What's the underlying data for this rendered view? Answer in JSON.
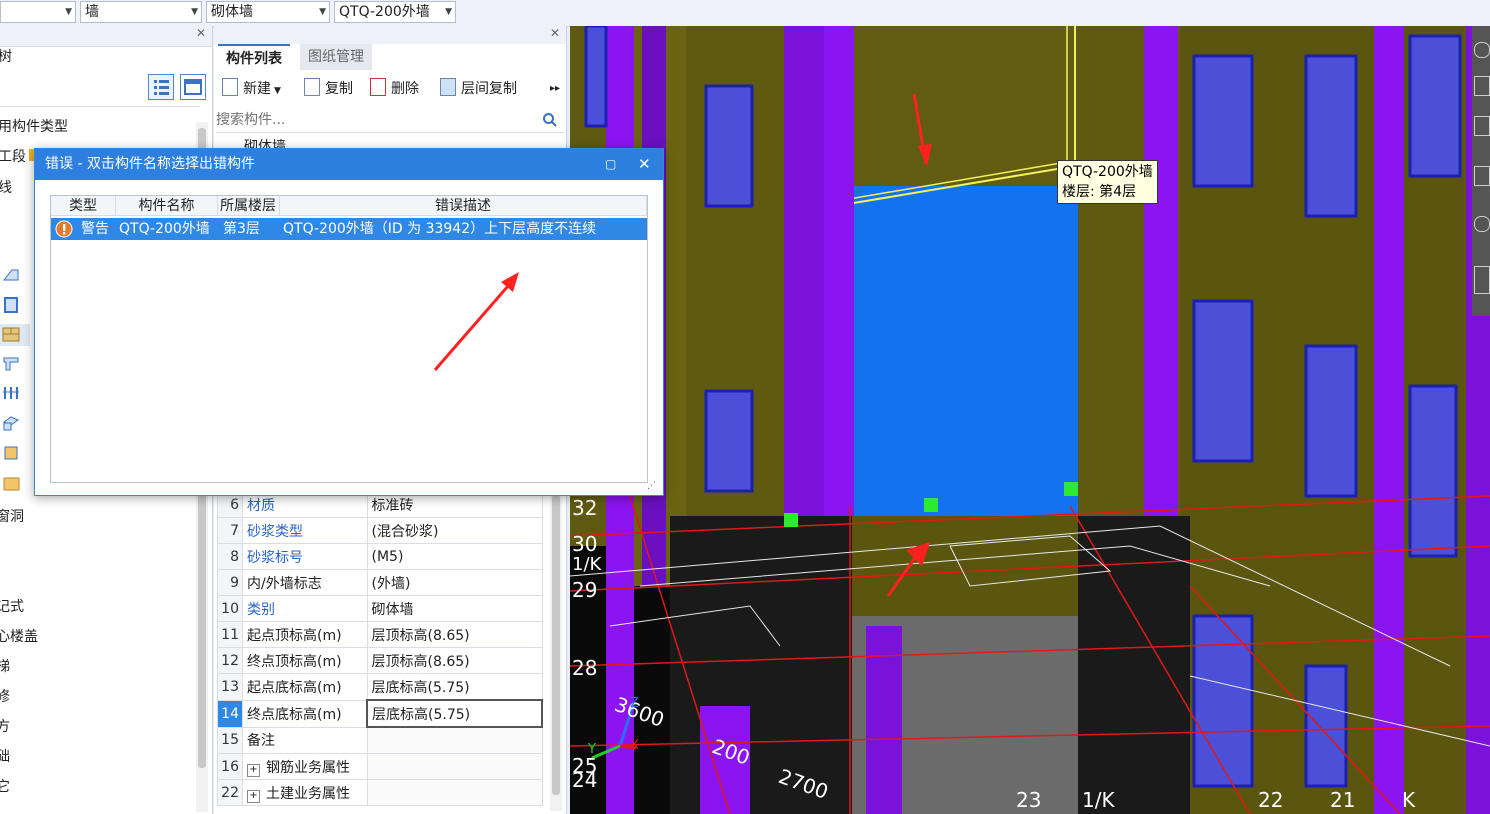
{
  "toolbar": {
    "combo1": "",
    "combo2": "墙",
    "combo3": "砌体墙",
    "combo4": "QTQ-200外墙"
  },
  "left_panel": {
    "partial_items": [
      "树",
      "用构件类型",
      "工段",
      "线",
      "窗洞",
      "记式",
      "心楼盖",
      "梯",
      "修",
      "方",
      "础",
      "它"
    ]
  },
  "mid_panel": {
    "tabs": [
      "构件列表",
      "图纸管理"
    ],
    "buttons": {
      "new": "新建",
      "copy": "复制",
      "delete": "删除",
      "floor_copy": "层间复制"
    },
    "search_placeholder": "搜索构件...",
    "partial_tree_text": "砌体墙",
    "props": [
      {
        "no": "6",
        "name": "材质",
        "value": "标准砖",
        "blue": true
      },
      {
        "no": "7",
        "name": "砂浆类型",
        "value": "(混合砂浆)",
        "blue": true
      },
      {
        "no": "8",
        "name": "砂浆标号",
        "value": "(M5)",
        "blue": true
      },
      {
        "no": "9",
        "name": "内/外墙标志",
        "value": "(外墙)",
        "blue": false
      },
      {
        "no": "10",
        "name": "类别",
        "value": "砌体墙",
        "blue": true
      },
      {
        "no": "11",
        "name": "起点顶标高(m)",
        "value": "层顶标高(8.65)",
        "blue": false
      },
      {
        "no": "12",
        "name": "终点顶标高(m)",
        "value": "层顶标高(8.65)",
        "blue": false
      },
      {
        "no": "13",
        "name": "起点底标高(m)",
        "value": "层底标高(5.75)",
        "blue": false
      },
      {
        "no": "14",
        "name": "终点底标高(m)",
        "value": "层底标高(5.75)",
        "blue": false
      },
      {
        "no": "15",
        "name": "备注",
        "value": "",
        "blue": false
      },
      {
        "no": "16",
        "name": "钢筋业务属性",
        "value": "",
        "blue": false,
        "expand": true
      },
      {
        "no": "22",
        "name": "土建业务属性",
        "value": "",
        "blue": false,
        "expand": true
      }
    ]
  },
  "dialog": {
    "title": "错误 - 双击构件名称选择出错构件",
    "columns": [
      "类型",
      "构件名称",
      "所属楼层",
      "错误描述"
    ],
    "row": {
      "type": "警告",
      "name": "QTQ-200外墙",
      "floor": "第3层",
      "desc": "QTQ-200外墙（ID 为 33942）上下层高度不连续"
    }
  },
  "viewport": {
    "tooltip_line1": "QTQ-200外墙",
    "tooltip_line2": "楼层: 第4层",
    "grid_labels": [
      "32",
      "30",
      "1/K",
      "29",
      "28",
      "25",
      "24",
      "23",
      "1/K",
      "22",
      "21",
      "K"
    ],
    "dims": [
      "3600",
      "200",
      "2700"
    ],
    "axis": [
      "Y",
      "X",
      "Z"
    ]
  },
  "colors": {
    "wall": "#5f5a10",
    "column": "#8b14f0",
    "selected_wall": "#1572ef",
    "window": "#3b3fd6",
    "dialog_title": "#2d7fe0",
    "highlight_row": "#2f88e6",
    "arrow": "#ff2020"
  }
}
